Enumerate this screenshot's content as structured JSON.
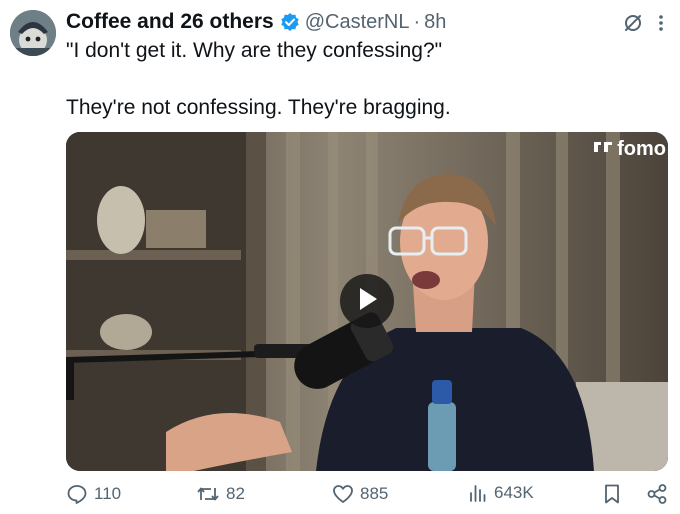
{
  "tweet": {
    "author": "Coffee and 26 others",
    "handle": "@CasterNL",
    "separator": "·",
    "time": "8h",
    "lines": [
      "\"I don't get it. Why are they confessing?\"",
      "They're not confessing. They're bragging."
    ]
  },
  "media": {
    "brand": "fomo",
    "brand_icon": "fomo-logo-icon",
    "play_icon": "play-icon"
  },
  "actions": {
    "replies": "110",
    "reposts": "82",
    "likes": "885",
    "views": "643K"
  },
  "icons": [
    "verified-badge-icon",
    "grok-icon",
    "more-icon",
    "reply-icon",
    "repost-icon",
    "like-icon",
    "views-icon",
    "bookmark-icon",
    "share-icon"
  ],
  "colors": {
    "text": "#0f1419",
    "muted": "#536471",
    "verified": "#1d9bf0"
  }
}
